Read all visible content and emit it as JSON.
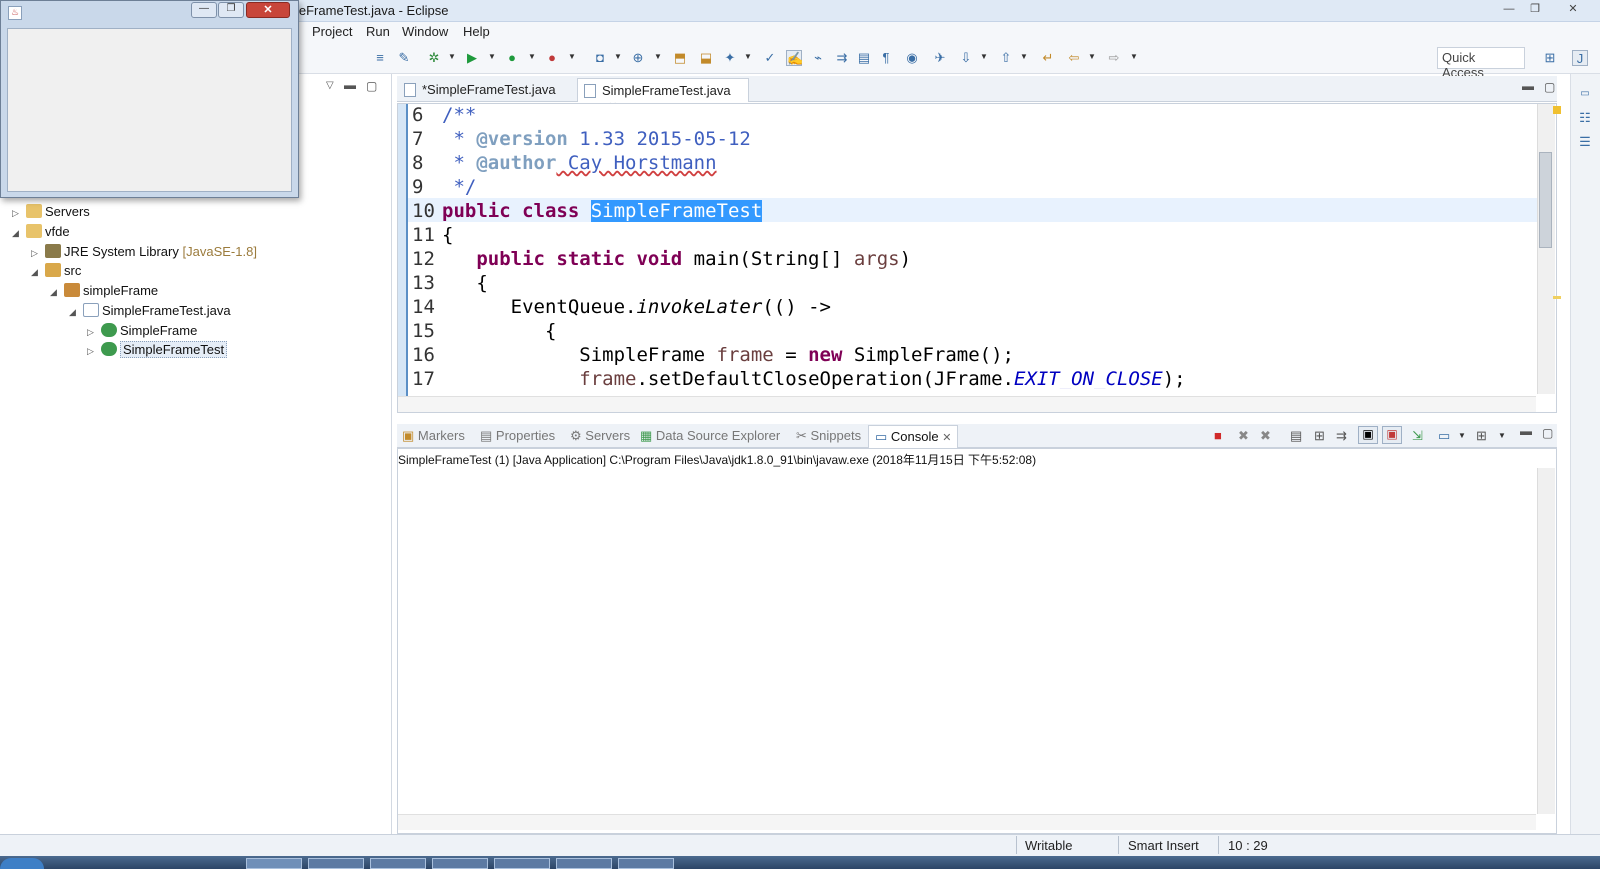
{
  "window": {
    "title": "leFrameTest.java - Eclipse",
    "min_glyph": "—",
    "max_glyph": "❐",
    "close_glyph": "✕"
  },
  "menu": {
    "items": [
      "Project",
      "Run",
      "Window",
      "Help"
    ]
  },
  "toolbar": {
    "quick_access": "Quick Access"
  },
  "explorer": {
    "items": [
      {
        "label": "Servers",
        "decor": ""
      },
      {
        "label": "vfde",
        "decor": ""
      },
      {
        "label": "JRE System Library",
        "decor": "[JavaSE-1.8]"
      },
      {
        "label": "src",
        "decor": ""
      },
      {
        "label": "simpleFrame",
        "decor": ""
      },
      {
        "label": "SimpleFrameTest.java",
        "decor": ""
      },
      {
        "label": "SimpleFrame",
        "decor": ""
      },
      {
        "label": "SimpleFrameTest",
        "decor": ""
      }
    ]
  },
  "editor": {
    "tabs": [
      {
        "label": "*SimpleFrameTest.java",
        "active": false
      },
      {
        "label": "SimpleFrameTest.java",
        "active": true
      }
    ],
    "line_numbers": [
      "6",
      "7",
      "8",
      "9",
      "10",
      "11",
      "12",
      "13",
      "14",
      "15",
      "16",
      "17"
    ],
    "code": {
      "l6": "/**",
      "l7_a": " * ",
      "l7_tag": "@version",
      "l7_b": " 1.33 2015-05-12",
      "l8_a": " * ",
      "l8_tag": "@author",
      "l8_b": " Cay Horstmann",
      "l9": " */",
      "l10_kw": "public class ",
      "l10_sel": "SimpleFrameTest",
      "l11": "{",
      "l12_kw": "   public static void ",
      "l12_a": "main(String[] ",
      "l12_var": "args",
      "l12_b": ")",
      "l13": "   {",
      "l14_a": "      EventQueue.",
      "l14_it": "invokeLater",
      "l14_b": "(() ->",
      "l15": "         {",
      "l16_a": "            SimpleFrame ",
      "l16_var": "frame",
      "l16_b": " = ",
      "l16_kw": "new",
      "l16_c": " SimpleFrame();",
      "l17_a": "            ",
      "l17_var": "frame",
      "l17_b": ".setDefaultCloseOperation(JFrame.",
      "l17_field": "EXIT_ON_CLOSE",
      "l17_c": ");"
    }
  },
  "console": {
    "tabs": [
      "Markers",
      "Properties",
      "Servers",
      "Data Source Explorer",
      "Snippets",
      "Console"
    ],
    "header": "SimpleFrameTest (1) [Java Application] C:\\Program Files\\Java\\jdk1.8.0_91\\bin\\javaw.exe (2018年11月15日 下午5:52:08)"
  },
  "status": {
    "writable": "Writable",
    "insert_mode": "Smart Insert",
    "position": "10 : 29"
  },
  "colors": {
    "selection": "#3399ff",
    "keyword": "#7f0055",
    "javadoc": "#3f5fbf"
  }
}
